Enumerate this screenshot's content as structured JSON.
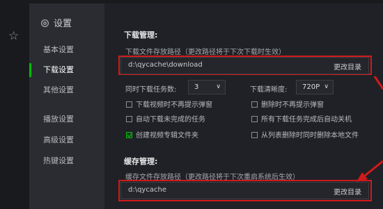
{
  "sidebar": {
    "title": "设置",
    "items": [
      {
        "label": "基本设置",
        "active": false
      },
      {
        "label": "下载设置",
        "active": true
      },
      {
        "label": "其他设置",
        "active": false
      },
      {
        "label": "播放设置",
        "active": false
      },
      {
        "label": "高级设置",
        "active": false
      },
      {
        "label": "热键设置",
        "active": false
      }
    ]
  },
  "download": {
    "title": "下载管理:",
    "path_desc": "下载文件存放路径（更改路径将于下次下载时生效）",
    "path": "d:\\qycache\\download",
    "change_btn": "更改目录",
    "tasks_label": "同时下载任务数:",
    "tasks_value": "3",
    "quality_label": "下载清晰度:",
    "quality_value": "720P",
    "options": [
      {
        "label": "下载视频时不再提示弹窗",
        "checked": false
      },
      {
        "label": "删除时不再提示弹窗",
        "checked": false
      },
      {
        "label": "自动下载未完成的任务",
        "checked": false
      },
      {
        "label": "所有下载任务完成后自动关机",
        "checked": false
      },
      {
        "label": "创建视频专辑文件夹",
        "checked": true
      },
      {
        "label": "从列表删除时同时删除本地文件",
        "checked": false
      }
    ]
  },
  "cache": {
    "title": "缓存管理:",
    "path_desc": "缓存文件存放路径（更改路径将于下次重启系统后生效）",
    "path": "d:\\qycache",
    "change_btn": "更改目录"
  },
  "colors": {
    "accent": "#00be06",
    "highlight": "#d11a1a",
    "sidebar": "#2b2c31",
    "panel": "#202126"
  }
}
